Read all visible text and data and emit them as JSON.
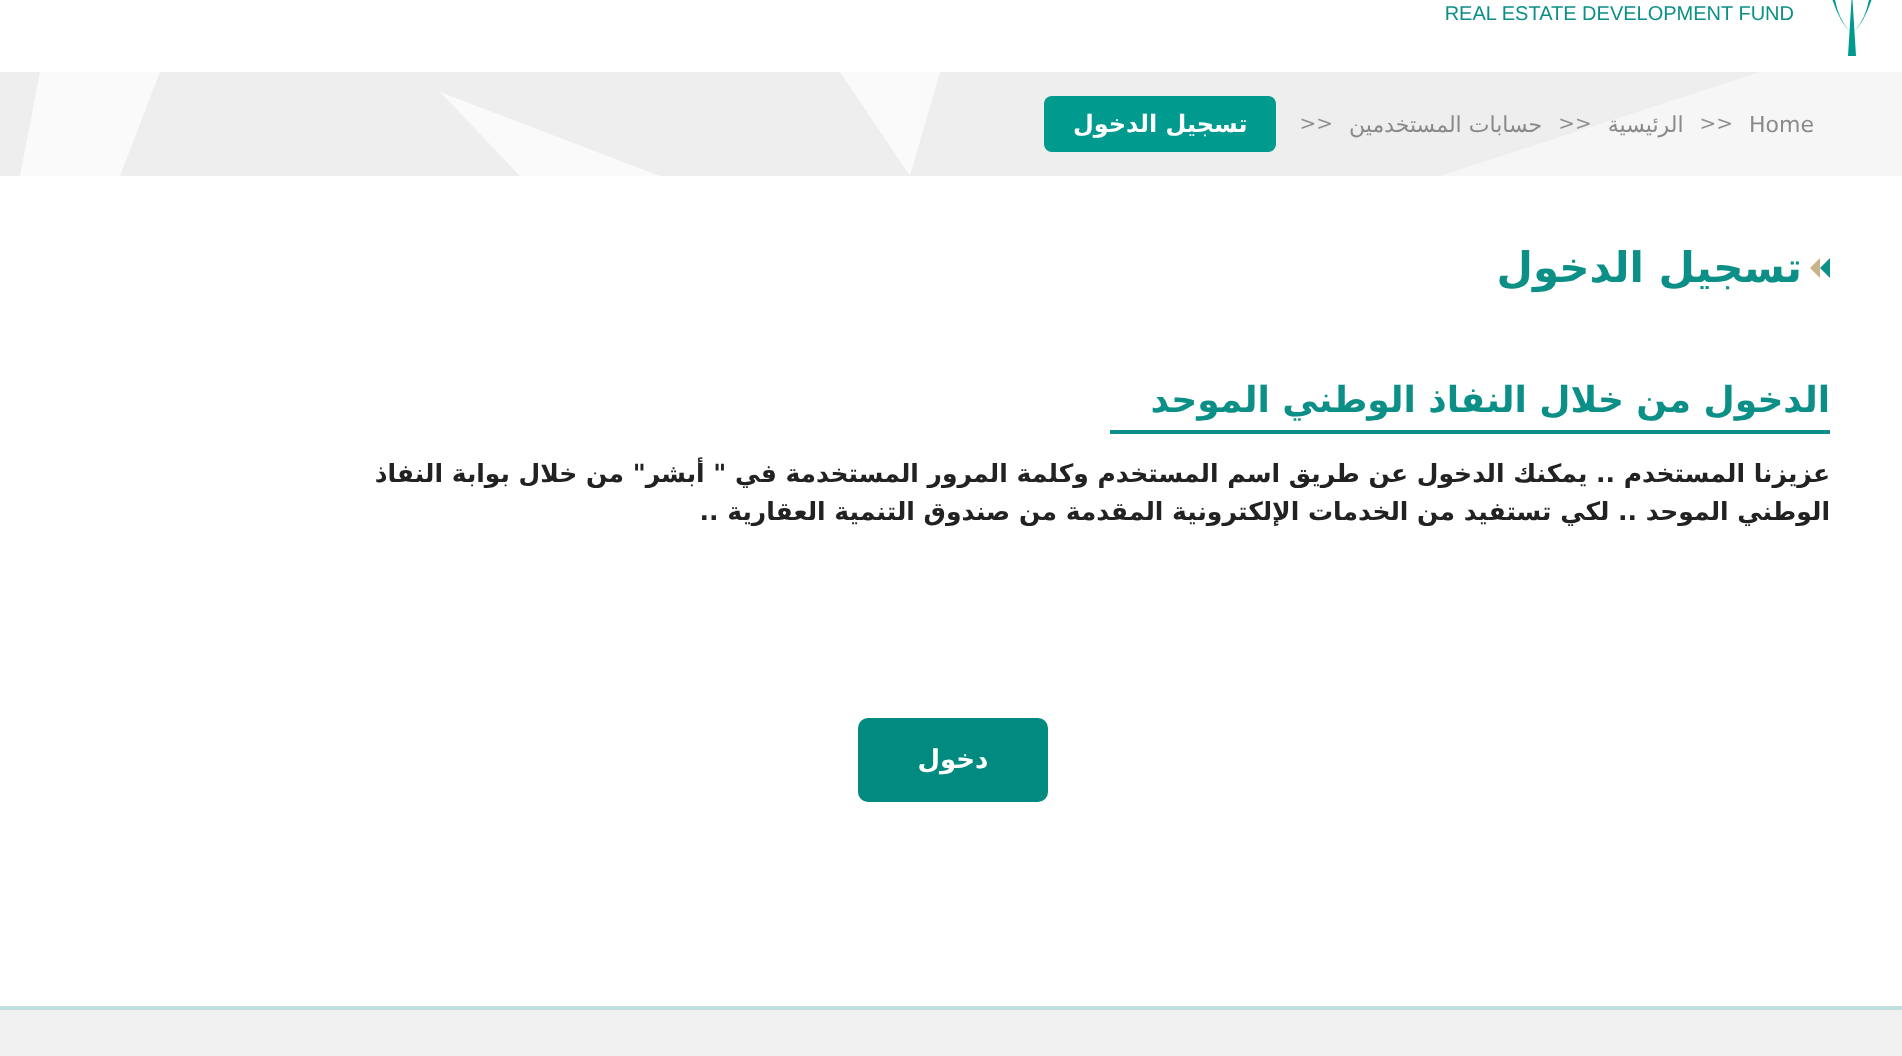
{
  "header": {
    "logo_caption": "REAL ESTATE DEVELOPMENT FUND"
  },
  "breadcrumb": {
    "items": [
      {
        "label": "Home"
      },
      {
        "label": "الرئيسية"
      },
      {
        "label": "حسابات المستخدمين"
      }
    ],
    "separator": ">>",
    "current": "تسجيل الدخول"
  },
  "page_title": "تسجيل الدخول",
  "section": {
    "heading": "الدخول من خلال النفاذ الوطني الموحد",
    "lines": [
      "عزيزنا المستخدم .. يمكنك الدخول عن طريق اسم المستخدم وكلمة المرور المستخدمة في \" أبشر\" من خلال بوابة النفاذ",
      "الوطني الموحد .. لكي تستفيد من الخدمات الإلكترونية المقدمة من صندوق التنمية العقارية .."
    ],
    "button": "دخول"
  }
}
